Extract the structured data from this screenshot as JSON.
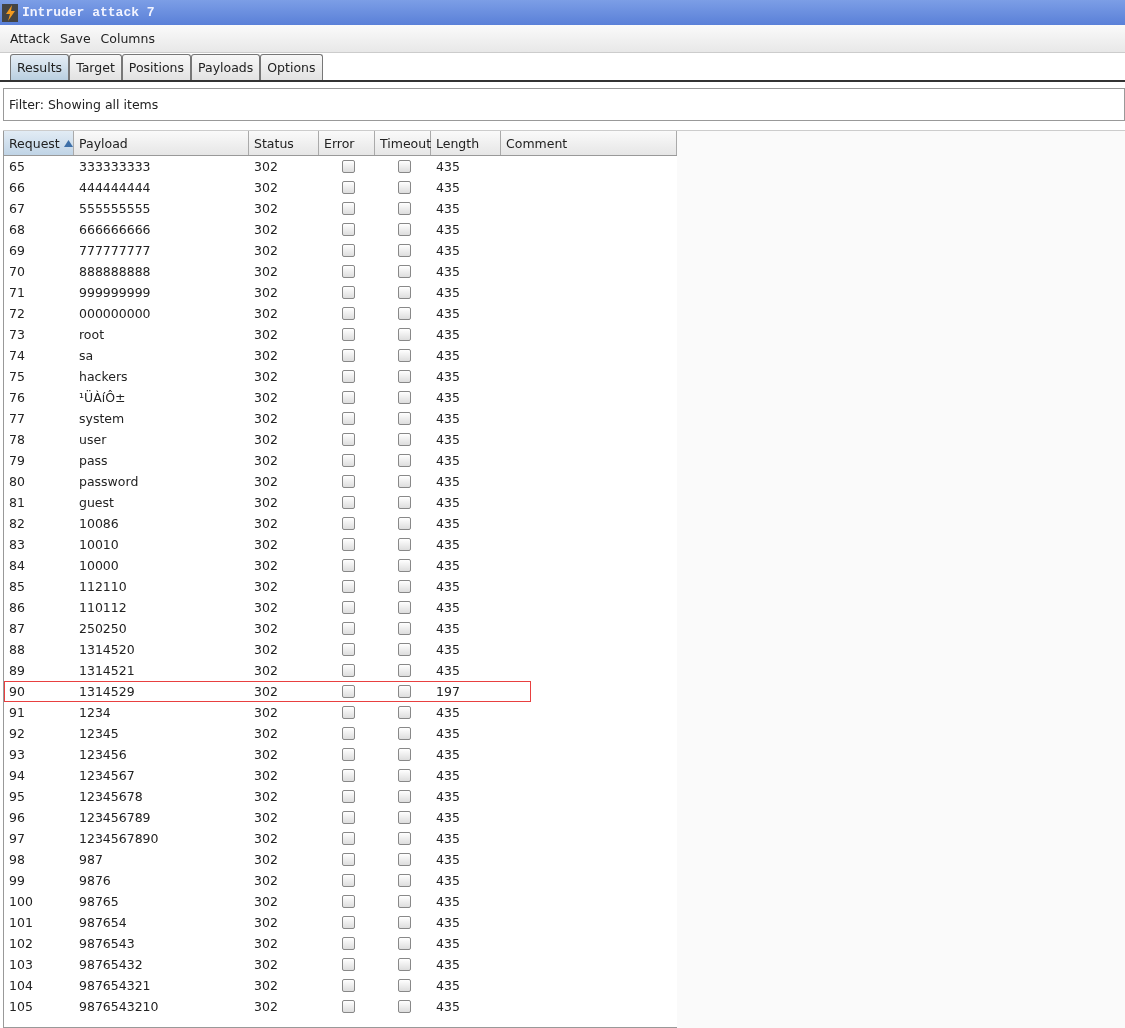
{
  "window": {
    "title": "Intruder attack 7"
  },
  "menu": [
    "Attack",
    "Save",
    "Columns"
  ],
  "tabs": [
    {
      "label": "Results",
      "selected": true
    },
    {
      "label": "Target",
      "selected": false
    },
    {
      "label": "Positions",
      "selected": false
    },
    {
      "label": "Payloads",
      "selected": false
    },
    {
      "label": "Options",
      "selected": false
    }
  ],
  "filter": "Filter: Showing all items",
  "table": {
    "columns": [
      {
        "label": "Request",
        "sorted": true
      },
      {
        "label": "Payload",
        "sorted": false
      },
      {
        "label": "Status",
        "sorted": false
      },
      {
        "label": "Error",
        "sorted": false
      },
      {
        "label": "Timeout",
        "sorted": false
      },
      {
        "label": "Length",
        "sorted": false
      },
      {
        "label": "Comment",
        "sorted": false
      }
    ],
    "rows": [
      {
        "request": "65",
        "payload": "333333333",
        "status": "302",
        "error": false,
        "timeout": false,
        "length": "435",
        "highlighted": false
      },
      {
        "request": "66",
        "payload": "444444444",
        "status": "302",
        "error": false,
        "timeout": false,
        "length": "435",
        "highlighted": false
      },
      {
        "request": "67",
        "payload": "555555555",
        "status": "302",
        "error": false,
        "timeout": false,
        "length": "435",
        "highlighted": false
      },
      {
        "request": "68",
        "payload": "666666666",
        "status": "302",
        "error": false,
        "timeout": false,
        "length": "435",
        "highlighted": false
      },
      {
        "request": "69",
        "payload": "777777777",
        "status": "302",
        "error": false,
        "timeout": false,
        "length": "435",
        "highlighted": false
      },
      {
        "request": "70",
        "payload": "888888888",
        "status": "302",
        "error": false,
        "timeout": false,
        "length": "435",
        "highlighted": false
      },
      {
        "request": "71",
        "payload": "999999999",
        "status": "302",
        "error": false,
        "timeout": false,
        "length": "435",
        "highlighted": false
      },
      {
        "request": "72",
        "payload": "000000000",
        "status": "302",
        "error": false,
        "timeout": false,
        "length": "435",
        "highlighted": false
      },
      {
        "request": "73",
        "payload": "root",
        "status": "302",
        "error": false,
        "timeout": false,
        "length": "435",
        "highlighted": false
      },
      {
        "request": "74",
        "payload": "sa",
        "status": "302",
        "error": false,
        "timeout": false,
        "length": "435",
        "highlighted": false
      },
      {
        "request": "75",
        "payload": "hackers",
        "status": "302",
        "error": false,
        "timeout": false,
        "length": "435",
        "highlighted": false
      },
      {
        "request": "76",
        "payload": "¹ÜÀíÔ±",
        "status": "302",
        "error": false,
        "timeout": false,
        "length": "435",
        "highlighted": false
      },
      {
        "request": "77",
        "payload": "system",
        "status": "302",
        "error": false,
        "timeout": false,
        "length": "435",
        "highlighted": false
      },
      {
        "request": "78",
        "payload": "user",
        "status": "302",
        "error": false,
        "timeout": false,
        "length": "435",
        "highlighted": false
      },
      {
        "request": "79",
        "payload": "pass",
        "status": "302",
        "error": false,
        "timeout": false,
        "length": "435",
        "highlighted": false
      },
      {
        "request": "80",
        "payload": "password",
        "status": "302",
        "error": false,
        "timeout": false,
        "length": "435",
        "highlighted": false
      },
      {
        "request": "81",
        "payload": "guest",
        "status": "302",
        "error": false,
        "timeout": false,
        "length": "435",
        "highlighted": false
      },
      {
        "request": "82",
        "payload": "10086",
        "status": "302",
        "error": false,
        "timeout": false,
        "length": "435",
        "highlighted": false
      },
      {
        "request": "83",
        "payload": "10010",
        "status": "302",
        "error": false,
        "timeout": false,
        "length": "435",
        "highlighted": false
      },
      {
        "request": "84",
        "payload": "10000",
        "status": "302",
        "error": false,
        "timeout": false,
        "length": "435",
        "highlighted": false
      },
      {
        "request": "85",
        "payload": "112110",
        "status": "302",
        "error": false,
        "timeout": false,
        "length": "435",
        "highlighted": false
      },
      {
        "request": "86",
        "payload": "110112",
        "status": "302",
        "error": false,
        "timeout": false,
        "length": "435",
        "highlighted": false
      },
      {
        "request": "87",
        "payload": "250250",
        "status": "302",
        "error": false,
        "timeout": false,
        "length": "435",
        "highlighted": false
      },
      {
        "request": "88",
        "payload": "1314520",
        "status": "302",
        "error": false,
        "timeout": false,
        "length": "435",
        "highlighted": false
      },
      {
        "request": "89",
        "payload": "1314521",
        "status": "302",
        "error": false,
        "timeout": false,
        "length": "435",
        "highlighted": false
      },
      {
        "request": "90",
        "payload": "1314529",
        "status": "302",
        "error": false,
        "timeout": false,
        "length": "197",
        "highlighted": true
      },
      {
        "request": "91",
        "payload": "1234",
        "status": "302",
        "error": false,
        "timeout": false,
        "length": "435",
        "highlighted": false
      },
      {
        "request": "92",
        "payload": "12345",
        "status": "302",
        "error": false,
        "timeout": false,
        "length": "435",
        "highlighted": false
      },
      {
        "request": "93",
        "payload": "123456",
        "status": "302",
        "error": false,
        "timeout": false,
        "length": "435",
        "highlighted": false
      },
      {
        "request": "94",
        "payload": "1234567",
        "status": "302",
        "error": false,
        "timeout": false,
        "length": "435",
        "highlighted": false
      },
      {
        "request": "95",
        "payload": "12345678",
        "status": "302",
        "error": false,
        "timeout": false,
        "length": "435",
        "highlighted": false
      },
      {
        "request": "96",
        "payload": "123456789",
        "status": "302",
        "error": false,
        "timeout": false,
        "length": "435",
        "highlighted": false
      },
      {
        "request": "97",
        "payload": "1234567890",
        "status": "302",
        "error": false,
        "timeout": false,
        "length": "435",
        "highlighted": false
      },
      {
        "request": "98",
        "payload": "987",
        "status": "302",
        "error": false,
        "timeout": false,
        "length": "435",
        "highlighted": false
      },
      {
        "request": "99",
        "payload": "9876",
        "status": "302",
        "error": false,
        "timeout": false,
        "length": "435",
        "highlighted": false
      },
      {
        "request": "100",
        "payload": "98765",
        "status": "302",
        "error": false,
        "timeout": false,
        "length": "435",
        "highlighted": false
      },
      {
        "request": "101",
        "payload": "987654",
        "status": "302",
        "error": false,
        "timeout": false,
        "length": "435",
        "highlighted": false
      },
      {
        "request": "102",
        "payload": "9876543",
        "status": "302",
        "error": false,
        "timeout": false,
        "length": "435",
        "highlighted": false
      },
      {
        "request": "103",
        "payload": "98765432",
        "status": "302",
        "error": false,
        "timeout": false,
        "length": "435",
        "highlighted": false
      },
      {
        "request": "104",
        "payload": "987654321",
        "status": "302",
        "error": false,
        "timeout": false,
        "length": "435",
        "highlighted": false
      },
      {
        "request": "105",
        "payload": "9876543210",
        "status": "302",
        "error": false,
        "timeout": false,
        "length": "435",
        "highlighted": false
      }
    ]
  }
}
